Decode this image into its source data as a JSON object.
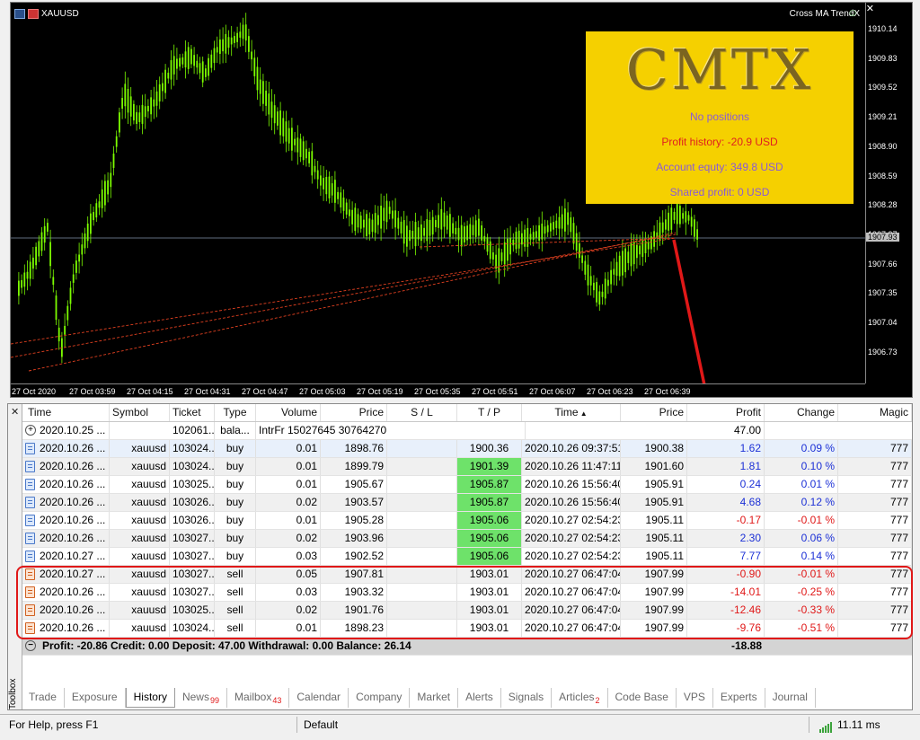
{
  "chart": {
    "symbol": "XAUUSD",
    "ea_name": "Cross MA TrendX",
    "y_ticks": [
      "1910.14",
      "1909.83",
      "1909.52",
      "1909.21",
      "1908.90",
      "1908.59",
      "1908.28",
      "1907.97",
      "1907.66",
      "1907.35",
      "1907.04",
      "1906.73"
    ],
    "current_price": "1907.93",
    "x_ticks": [
      "27 Oct 2020",
      "27 Oct 03:59",
      "27 Oct 04:15",
      "27 Oct 04:31",
      "27 Oct 04:47",
      "27 Oct 05:03",
      "27 Oct 05:19",
      "27 Oct 05:35",
      "27 Oct 05:51",
      "27 Oct 06:07",
      "27 Oct 06:23",
      "27 Oct 06:39"
    ],
    "colors": {
      "background": "#000000",
      "candle": "#7CFC00",
      "trade_line": "#e04020"
    }
  },
  "panel": {
    "logo": "CMTX",
    "positions": "No positions",
    "profit_history": "Profit history: -20.9 USD",
    "account_equity": "Account equty: 349.8 USD",
    "shared_profit": "Shared profit: 0 USD"
  },
  "toolbox": {
    "label": "Toolbox",
    "columns": [
      "Time",
      "Symbol",
      "Ticket",
      "Type",
      "Volume",
      "Price",
      "S / L",
      "T / P",
      "Time",
      "Price",
      "Profit",
      "Change",
      "Magic"
    ],
    "balance_row": {
      "time": "2020.10.25 ...",
      "ticket": "102061...",
      "type": "bala...",
      "comment": "IntrFr 15027645 30764270",
      "profit": "47.00"
    },
    "rows": [
      {
        "time": "2020.10.26 ...",
        "symbol": "xauusd",
        "ticket": "103024...",
        "type": "buy",
        "volume": "0.01",
        "price": "1898.76",
        "sl": "",
        "tp": "1900.36",
        "close_time": "2020.10.26 09:37:51",
        "close_price": "1900.38",
        "profit": "1.62",
        "change": "0.09 %",
        "magic": "777",
        "tp_hit": false,
        "kind": "buy"
      },
      {
        "time": "2020.10.26 ...",
        "symbol": "xauusd",
        "ticket": "103024...",
        "type": "buy",
        "volume": "0.01",
        "price": "1899.79",
        "sl": "",
        "tp": "1901.39",
        "close_time": "2020.10.26 11:47:11",
        "close_price": "1901.60",
        "profit": "1.81",
        "change": "0.10 %",
        "magic": "777",
        "tp_hit": true,
        "kind": "buy"
      },
      {
        "time": "2020.10.26 ...",
        "symbol": "xauusd",
        "ticket": "103025...",
        "type": "buy",
        "volume": "0.01",
        "price": "1905.67",
        "sl": "",
        "tp": "1905.87",
        "close_time": "2020.10.26 15:56:40",
        "close_price": "1905.91",
        "profit": "0.24",
        "change": "0.01 %",
        "magic": "777",
        "tp_hit": true,
        "kind": "buy"
      },
      {
        "time": "2020.10.26 ...",
        "symbol": "xauusd",
        "ticket": "103026...",
        "type": "buy",
        "volume": "0.02",
        "price": "1903.57",
        "sl": "",
        "tp": "1905.87",
        "close_time": "2020.10.26 15:56:40",
        "close_price": "1905.91",
        "profit": "4.68",
        "change": "0.12 %",
        "magic": "777",
        "tp_hit": true,
        "kind": "buy"
      },
      {
        "time": "2020.10.26 ...",
        "symbol": "xauusd",
        "ticket": "103026...",
        "type": "buy",
        "volume": "0.01",
        "price": "1905.28",
        "sl": "",
        "tp": "1905.06",
        "close_time": "2020.10.27 02:54:23",
        "close_price": "1905.11",
        "profit": "-0.17",
        "change": "-0.01 %",
        "magic": "777",
        "tp_hit": true,
        "kind": "buy"
      },
      {
        "time": "2020.10.26 ...",
        "symbol": "xauusd",
        "ticket": "103027...",
        "type": "buy",
        "volume": "0.02",
        "price": "1903.96",
        "sl": "",
        "tp": "1905.06",
        "close_time": "2020.10.27 02:54:23",
        "close_price": "1905.11",
        "profit": "2.30",
        "change": "0.06 %",
        "magic": "777",
        "tp_hit": true,
        "kind": "buy"
      },
      {
        "time": "2020.10.27 ...",
        "symbol": "xauusd",
        "ticket": "103027...",
        "type": "buy",
        "volume": "0.03",
        "price": "1902.52",
        "sl": "",
        "tp": "1905.06",
        "close_time": "2020.10.27 02:54:23",
        "close_price": "1905.11",
        "profit": "7.77",
        "change": "0.14 %",
        "magic": "777",
        "tp_hit": true,
        "kind": "buy"
      },
      {
        "time": "2020.10.27 ...",
        "symbol": "xauusd",
        "ticket": "103027...",
        "type": "sell",
        "volume": "0.05",
        "price": "1907.81",
        "sl": "",
        "tp": "1903.01",
        "close_time": "2020.10.27 06:47:04",
        "close_price": "1907.99",
        "profit": "-0.90",
        "change": "-0.01 %",
        "magic": "777",
        "tp_hit": false,
        "kind": "sell"
      },
      {
        "time": "2020.10.26 ...",
        "symbol": "xauusd",
        "ticket": "103027...",
        "type": "sell",
        "volume": "0.03",
        "price": "1903.32",
        "sl": "",
        "tp": "1903.01",
        "close_time": "2020.10.27 06:47:04",
        "close_price": "1907.99",
        "profit": "-14.01",
        "change": "-0.25 %",
        "magic": "777",
        "tp_hit": false,
        "kind": "sell"
      },
      {
        "time": "2020.10.26 ...",
        "symbol": "xauusd",
        "ticket": "103025...",
        "type": "sell",
        "volume": "0.02",
        "price": "1901.76",
        "sl": "",
        "tp": "1903.01",
        "close_time": "2020.10.27 06:47:04",
        "close_price": "1907.99",
        "profit": "-12.46",
        "change": "-0.33 %",
        "magic": "777",
        "tp_hit": false,
        "kind": "sell"
      },
      {
        "time": "2020.10.26 ...",
        "symbol": "xauusd",
        "ticket": "103024...",
        "type": "sell",
        "volume": "0.01",
        "price": "1898.23",
        "sl": "",
        "tp": "1903.01",
        "close_time": "2020.10.27 06:47:04",
        "close_price": "1907.99",
        "profit": "-9.76",
        "change": "-0.51 %",
        "magic": "777",
        "tp_hit": false,
        "kind": "sell"
      }
    ],
    "summary": "Profit: -20.86  Credit: 0.00  Deposit: 47.00  Withdrawal: 0.00  Balance: 26.14",
    "summary_profit": "-18.88"
  },
  "tabs": [
    {
      "label": "Trade",
      "badge": ""
    },
    {
      "label": "Exposure",
      "badge": ""
    },
    {
      "label": "History",
      "badge": "",
      "active": true
    },
    {
      "label": "News",
      "badge": "99"
    },
    {
      "label": "Mailbox",
      "badge": "43"
    },
    {
      "label": "Calendar",
      "badge": ""
    },
    {
      "label": "Company",
      "badge": ""
    },
    {
      "label": "Market",
      "badge": ""
    },
    {
      "label": "Alerts",
      "badge": ""
    },
    {
      "label": "Signals",
      "badge": ""
    },
    {
      "label": "Articles",
      "badge": "2"
    },
    {
      "label": "Code Base",
      "badge": ""
    },
    {
      "label": "VPS",
      "badge": ""
    },
    {
      "label": "Experts",
      "badge": ""
    },
    {
      "label": "Journal",
      "badge": ""
    }
  ],
  "status": {
    "help": "For Help, press F1",
    "profile": "Default",
    "ping": "11.11 ms"
  }
}
